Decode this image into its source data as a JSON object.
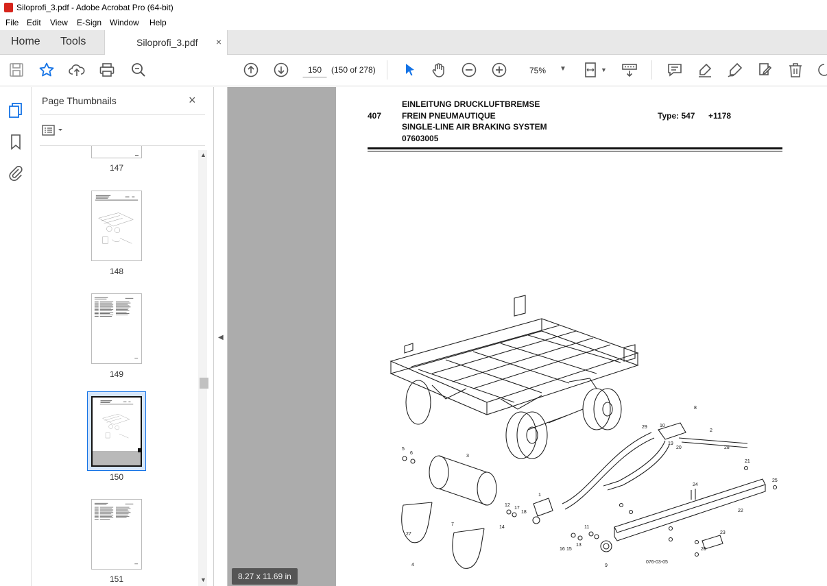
{
  "window": {
    "title": "Siloprofi_3.pdf - Adobe Acrobat Pro (64-bit)"
  },
  "menu": [
    "File",
    "Edit",
    "View",
    "E-Sign",
    "Window",
    "Help"
  ],
  "tabs": {
    "home": "Home",
    "tools": "Tools",
    "document": "Siloprofi_3.pdf",
    "close": "×"
  },
  "toolbar": {
    "page_value": "150",
    "page_count": "(150 of 278)",
    "zoom": "75%",
    "icons": [
      "save-icon",
      "star-icon",
      "upload-icon",
      "print-icon",
      "zoom-search-icon",
      "page-up-icon",
      "page-down-icon",
      "select-arrow-icon",
      "hand-icon",
      "zoom-out-icon",
      "zoom-in-icon",
      "fit-page-icon",
      "scroll-mode-icon",
      "comment-icon",
      "highlight-icon",
      "sign-icon",
      "edit-icon",
      "delete-icon"
    ]
  },
  "thumbnail_panel": {
    "title": "Page Thumbnails",
    "close": "×",
    "pages": [
      {
        "label": "147"
      },
      {
        "label": "148"
      },
      {
        "label": "149"
      },
      {
        "label": "150",
        "selected": true
      },
      {
        "label": "151"
      }
    ]
  },
  "document": {
    "header": {
      "number": "407",
      "line1": "EINLEITUNG DRUCKLUFTBREMSE",
      "line2": "FREIN PNEUMAUTIQUE",
      "line3": "SINGLE-LINE AIR BRAKING SYSTEM",
      "line4": "07603005",
      "type": "Type: 547",
      "code": "+1178"
    },
    "figure_id": "076-03-05",
    "part_labels": [
      "1",
      "2",
      "3",
      "4",
      "5",
      "6",
      "7",
      "8",
      "9",
      "10",
      "11",
      "12",
      "13",
      "14",
      "15",
      "16",
      "17",
      "18",
      "19",
      "20",
      "21",
      "22",
      "23",
      "24",
      "25",
      "26",
      "27",
      "28",
      "29"
    ],
    "page_size": "8.27 x 11.69 in"
  },
  "colors": {
    "accent": "#1473e6",
    "doc_bg": "#acacac",
    "selected_thumb": "#1473e6"
  }
}
